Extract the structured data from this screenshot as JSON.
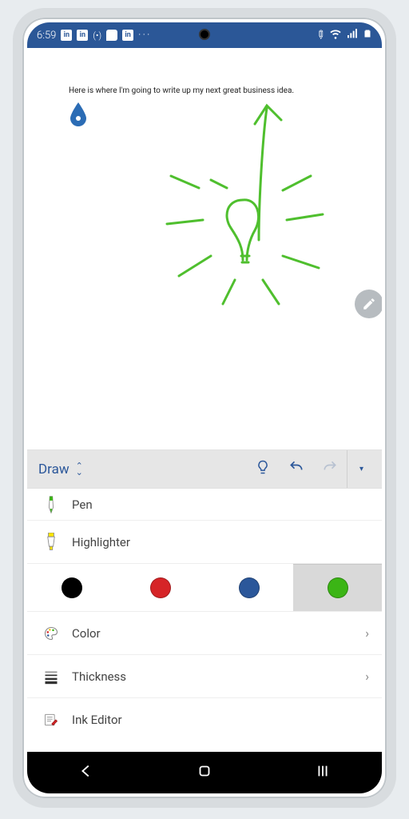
{
  "status": {
    "time": "6:59",
    "dots": "···"
  },
  "document": {
    "text": "Here is where I'm going to write up my next great business idea."
  },
  "ribbon": {
    "tab_label": "Draw"
  },
  "tools": {
    "pen": "Pen",
    "highlighter": "Highlighter",
    "color": "Color",
    "thickness": "Thickness",
    "ink_editor": "Ink Editor"
  },
  "swatches": {
    "colors": [
      "#000000",
      "#d62427",
      "#2b579a",
      "#3bb515"
    ],
    "selected_index": 3
  }
}
